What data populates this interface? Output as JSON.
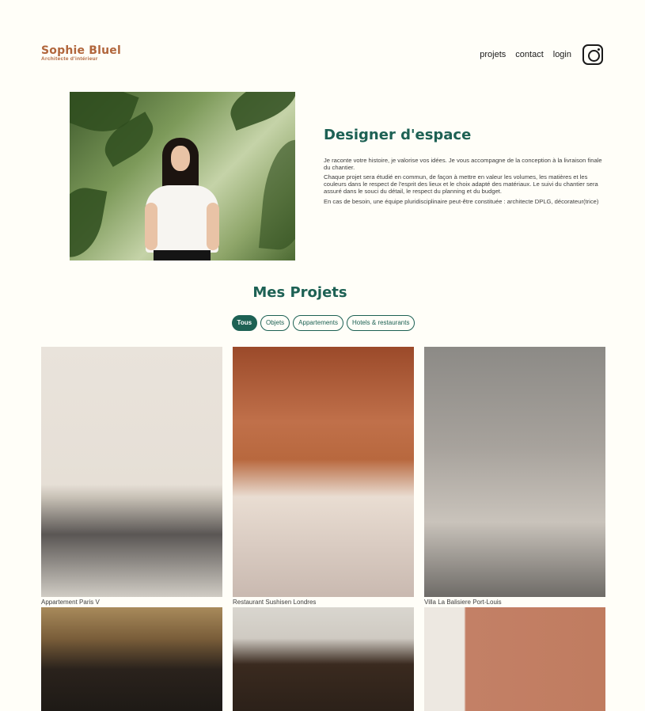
{
  "header": {
    "brand_name": "Sophie Bluel",
    "brand_subtitle": "Architecte d'intérieur",
    "nav": [
      "projets",
      "contact",
      "login"
    ],
    "social_icon": "instagram-icon"
  },
  "about": {
    "title": "Designer d'espace",
    "paragraphs": [
      "Je raconte votre histoire, je valorise vos idées. Je vous accompagne de la conception à la livraison finale du chantier.",
      "Chaque projet sera étudié en commun, de façon à mettre en valeur les volumes, les matières et les couleurs dans le respect de l'esprit des lieux et le choix adapté des matériaux. Le suivi du chantier sera assuré dans le souci du détail, le respect du planning et du budget.",
      "En cas de besoin, une équipe pluridisciplinaire peut-être constituée : architecte DPLG, décorateur(trice)"
    ]
  },
  "projects": {
    "title": "Mes Projets",
    "filters": [
      "Tous",
      "Objets",
      "Appartements",
      "Hotels & restaurants"
    ],
    "active_filter": "Tous",
    "items": [
      {
        "caption": "Appartement Paris V"
      },
      {
        "caption": "Restaurant Sushisen Londres"
      },
      {
        "caption": "Villa La Balisiere Port-Louis"
      },
      {
        "caption": ""
      },
      {
        "caption": ""
      },
      {
        "caption": ""
      }
    ]
  },
  "colors": {
    "accent": "#1D6154",
    "brand": "#B1663C",
    "background": "#FFFEF8"
  }
}
